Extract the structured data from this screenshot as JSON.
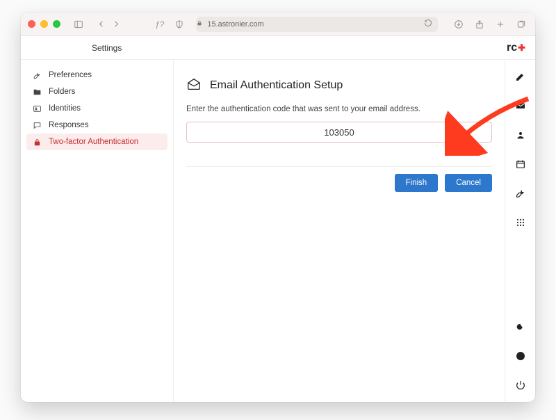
{
  "browser": {
    "url_host": "15.astronier.com"
  },
  "app": {
    "topbar_title": "Settings",
    "logo_text": "rc"
  },
  "sidebar": {
    "items": [
      {
        "label": "Preferences"
      },
      {
        "label": "Folders"
      },
      {
        "label": "Identities"
      },
      {
        "label": "Responses"
      },
      {
        "label": "Two-factor Authentication"
      }
    ],
    "active_index": 4
  },
  "main": {
    "title": "Email Authentication Setup",
    "description": "Enter the authentication code that was sent to your email address.",
    "code_value": "103050",
    "buttons": {
      "finish": "Finish",
      "cancel": "Cancel"
    }
  }
}
